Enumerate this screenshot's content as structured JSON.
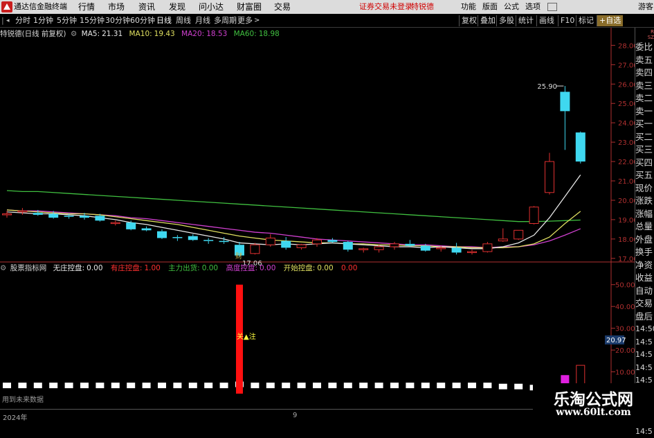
{
  "menubar": {
    "app_title": "通达信金融终端",
    "menus": [
      "行情",
      "市场",
      "资讯",
      "发现",
      "问小达",
      "财富圈",
      "交易"
    ],
    "notice": "证券交易未登录",
    "stock_tag": "特锐德",
    "right_items": [
      "功能",
      "版面",
      "公式",
      "选项"
    ],
    "guest": "游客"
  },
  "toolbar": {
    "periods": [
      "分时",
      "1分钟",
      "5分钟",
      "15分钟",
      "30分钟",
      "60分钟",
      "日线",
      "周线",
      "月线",
      "多周期",
      "更多"
    ],
    "active_period": "日线",
    "buttons": [
      "复权",
      "叠加",
      "多股",
      "统计",
      "画线",
      "F10",
      "标记",
      "+自选"
    ]
  },
  "main_info": {
    "title": "特锐德(日线 前复权)",
    "ma5_label": "MA5:",
    "ma5": "21.31",
    "ma10_label": "MA10:",
    "ma10": "19.43",
    "ma20_label": "MA20:",
    "ma20": "18.53",
    "ma60_label": "MA60:",
    "ma60": "18.98"
  },
  "indicator_info": {
    "name": "股票指标网",
    "items": [
      {
        "label": "无庄控盘:",
        "value": "0.00"
      },
      {
        "label": "有庄控盘:",
        "value": "1.00"
      },
      {
        "label": "主力出货:",
        "value": "0.00"
      },
      {
        "label": "高度控盘:",
        "value": "0.00"
      },
      {
        "label": "开始控盘:",
        "value": "0.00"
      },
      {
        "label": "",
        "value": "0.00"
      }
    ],
    "signal_text": "关▲注",
    "footer_text": "用到未来数据"
  },
  "price_axis": {
    "ticks": [
      "28.00",
      "27.00",
      "26.00",
      "25.00",
      "24.00",
      "23.00",
      "22.00",
      "21.00",
      "20.00",
      "19.00",
      "18.00",
      "17.00"
    ],
    "high_label": "25.90",
    "low_label": "17.06",
    "event_label": "财"
  },
  "indicator_axis": {
    "ticks": [
      "50.00",
      "40.00",
      "30.00",
      "20.00",
      "10.00"
    ],
    "current": "20.97"
  },
  "right_panel": {
    "items": [
      "委比",
      "卖五",
      "卖四",
      "卖三",
      "卖二",
      "卖一",
      "买一",
      "买二",
      "买三",
      "买四",
      "买五",
      "现价",
      "涨跌",
      "涨幅",
      "总量",
      "外盘",
      "换手",
      "净资",
      "收益",
      "自动",
      "交易",
      "盘后",
      "14:50",
      "14:5",
      "14:5",
      "14:5",
      "14:5",
      "14:5",
      "14:5",
      "14:5",
      "14:5"
    ],
    "small_top": "R",
    "small_bottom": "SZ"
  },
  "x_axis": {
    "year_label": "2024年",
    "month_label": "9"
  },
  "watermark": {
    "line1": "乐淘公式网",
    "line2": "www.60lt.com"
  },
  "colors": {
    "up": "#e03030",
    "down": "#3fd8f0",
    "ma5": "#e8e8e8",
    "ma10": "#e0e060",
    "ma20": "#d040d0",
    "ma60": "#40c040",
    "axis": "#b03030",
    "grid": "#5a1a1a",
    "signal_bar": "#ff1010"
  },
  "chart_data": {
    "type": "candlestick",
    "title": "特锐德(日线 前复权)",
    "candles": [
      {
        "o": 19.3,
        "h": 19.45,
        "l": 19.1,
        "c": 19.3
      },
      {
        "o": 19.45,
        "h": 19.6,
        "l": 19.25,
        "c": 19.45
      },
      {
        "o": 19.35,
        "h": 19.5,
        "l": 19.2,
        "c": 19.25
      },
      {
        "o": 19.3,
        "h": 19.45,
        "l": 19.05,
        "c": 19.1
      },
      {
        "o": 19.2,
        "h": 19.3,
        "l": 19.05,
        "c": 19.15
      },
      {
        "o": 19.2,
        "h": 19.35,
        "l": 19.0,
        "c": 19.1
      },
      {
        "o": 19.2,
        "h": 19.3,
        "l": 18.9,
        "c": 18.95
      },
      {
        "o": 18.8,
        "h": 18.95,
        "l": 18.7,
        "c": 18.85
      },
      {
        "o": 18.85,
        "h": 18.95,
        "l": 18.45,
        "c": 18.5
      },
      {
        "o": 18.55,
        "h": 18.65,
        "l": 18.4,
        "c": 18.45
      },
      {
        "o": 18.4,
        "h": 18.5,
        "l": 18.0,
        "c": 18.05
      },
      {
        "o": 18.1,
        "h": 18.2,
        "l": 17.9,
        "c": 18.05
      },
      {
        "o": 18.15,
        "h": 18.25,
        "l": 17.9,
        "c": 17.95
      },
      {
        "o": 17.95,
        "h": 18.05,
        "l": 17.75,
        "c": 17.9
      },
      {
        "o": 17.9,
        "h": 18.1,
        "l": 17.75,
        "c": 17.85
      },
      {
        "o": 17.7,
        "h": 17.85,
        "l": 17.06,
        "c": 17.15
      },
      {
        "o": 17.25,
        "h": 17.8,
        "l": 17.2,
        "c": 17.7
      },
      {
        "o": 17.7,
        "h": 18.25,
        "l": 17.6,
        "c": 18.05
      },
      {
        "o": 17.9,
        "h": 18.1,
        "l": 17.45,
        "c": 17.55
      },
      {
        "o": 17.55,
        "h": 17.75,
        "l": 17.45,
        "c": 17.7
      },
      {
        "o": 17.75,
        "h": 18.05,
        "l": 17.6,
        "c": 17.95
      },
      {
        "o": 17.95,
        "h": 18.05,
        "l": 17.8,
        "c": 17.85
      },
      {
        "o": 17.85,
        "h": 17.9,
        "l": 17.35,
        "c": 17.45
      },
      {
        "o": 17.45,
        "h": 17.55,
        "l": 17.3,
        "c": 17.5
      },
      {
        "o": 17.45,
        "h": 17.7,
        "l": 17.3,
        "c": 17.6
      },
      {
        "o": 17.6,
        "h": 17.85,
        "l": 17.45,
        "c": 17.75
      },
      {
        "o": 17.75,
        "h": 17.95,
        "l": 17.6,
        "c": 17.65
      },
      {
        "o": 17.65,
        "h": 17.75,
        "l": 17.35,
        "c": 17.4
      },
      {
        "o": 17.55,
        "h": 17.65,
        "l": 17.35,
        "c": 17.55
      },
      {
        "o": 17.55,
        "h": 17.8,
        "l": 17.2,
        "c": 17.3
      },
      {
        "o": 17.3,
        "h": 17.45,
        "l": 17.2,
        "c": 17.35
      },
      {
        "o": 17.35,
        "h": 17.85,
        "l": 17.3,
        "c": 17.75
      },
      {
        "o": 17.9,
        "h": 18.55,
        "l": 17.85,
        "c": 18.0
      },
      {
        "o": 18.0,
        "h": 18.45,
        "l": 17.95,
        "c": 18.45
      },
      {
        "o": 18.8,
        "h": 19.7,
        "l": 18.75,
        "c": 19.65
      },
      {
        "o": 20.4,
        "h": 22.45,
        "l": 20.3,
        "c": 22.0
      },
      {
        "o": 25.6,
        "h": 25.9,
        "l": 22.6,
        "c": 24.6
      },
      {
        "o": 23.5,
        "h": 23.55,
        "l": 21.9,
        "c": 22.0
      }
    ],
    "ma5": [
      19.4,
      19.35,
      19.3,
      19.3,
      19.25,
      19.2,
      19.1,
      19.0,
      18.85,
      18.75,
      18.6,
      18.45,
      18.3,
      18.15,
      18.0,
      17.8,
      17.75,
      17.7,
      17.75,
      17.7,
      17.75,
      17.8,
      17.75,
      17.7,
      17.65,
      17.6,
      17.6,
      17.55,
      17.6,
      17.55,
      17.5,
      17.5,
      17.6,
      17.8,
      18.2,
      19.1,
      20.2,
      21.31
    ],
    "ma10": [
      19.5,
      19.45,
      19.4,
      19.35,
      19.3,
      19.3,
      19.25,
      19.15,
      19.05,
      18.95,
      18.85,
      18.75,
      18.6,
      18.45,
      18.3,
      18.15,
      18.05,
      17.95,
      17.9,
      17.85,
      17.8,
      17.8,
      17.75,
      17.75,
      17.7,
      17.7,
      17.65,
      17.65,
      17.6,
      17.6,
      17.55,
      17.55,
      17.55,
      17.6,
      17.75,
      18.1,
      18.8,
      19.43
    ],
    "ma20": [
      19.5,
      19.45,
      19.45,
      19.4,
      19.35,
      19.3,
      19.25,
      19.2,
      19.1,
      19.05,
      18.95,
      18.85,
      18.75,
      18.65,
      18.55,
      18.45,
      18.35,
      18.3,
      18.2,
      18.1,
      18.0,
      17.95,
      17.9,
      17.85,
      17.8,
      17.75,
      17.7,
      17.7,
      17.65,
      17.6,
      17.6,
      17.55,
      17.6,
      17.6,
      17.7,
      17.9,
      18.2,
      18.53
    ],
    "ma60": [
      20.5,
      20.45,
      20.45,
      20.4,
      20.35,
      20.3,
      20.25,
      20.2,
      20.15,
      20.1,
      20.05,
      20.0,
      19.95,
      19.9,
      19.85,
      19.8,
      19.75,
      19.7,
      19.65,
      19.6,
      19.55,
      19.5,
      19.45,
      19.4,
      19.35,
      19.3,
      19.25,
      19.2,
      19.15,
      19.1,
      19.05,
      19.0,
      18.95,
      18.9,
      18.9,
      18.92,
      18.95,
      18.98
    ],
    "ylim": [
      16.85,
      28.3
    ],
    "indicator": {
      "ylim": [
        0,
        55
      ],
      "signal_index": 15,
      "signal_value": 50,
      "bars": [
        2.5,
        2.5,
        2.5,
        2.5,
        2.5,
        2.5,
        2.5,
        2.5,
        2.5,
        2.5,
        2.5,
        2.5,
        2.5,
        2.5,
        2.5,
        3.0,
        2.5,
        2.5,
        2.5,
        2.5,
        2.5,
        2.5,
        2.5,
        2.5,
        2.5,
        2.5,
        2.5,
        2.5,
        2.5,
        2.5,
        2.5,
        2.5,
        2.0,
        2.0,
        1.5,
        1.5,
        1.0,
        1.0
      ]
    }
  }
}
